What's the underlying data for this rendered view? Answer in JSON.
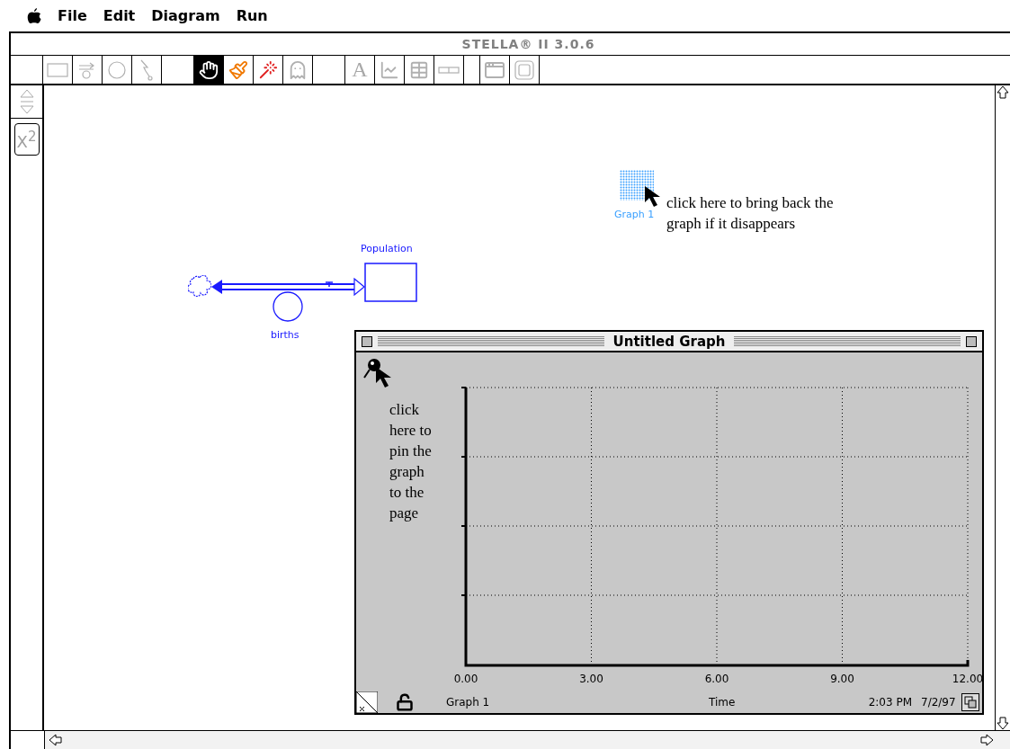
{
  "menu_bar": {
    "items": [
      "File",
      "Edit",
      "Diagram",
      "Run"
    ]
  },
  "window": {
    "title": "STELLA® II 3.0.6"
  },
  "toolbar": {
    "tools": [
      {
        "kind": "stock",
        "selected": false
      },
      {
        "kind": "flow",
        "selected": false
      },
      {
        "kind": "converter",
        "selected": false
      },
      {
        "kind": "connector",
        "selected": false
      },
      {
        "kind": "blank",
        "selected": false
      },
      {
        "kind": "hand",
        "selected": true
      },
      {
        "kind": "paintbrush",
        "selected": false
      },
      {
        "kind": "dynamite",
        "selected": false
      },
      {
        "kind": "ghost",
        "selected": false
      },
      {
        "kind": "blank",
        "selected": false
      },
      {
        "kind": "text",
        "label": "A",
        "selected": false
      },
      {
        "kind": "graph",
        "selected": false
      },
      {
        "kind": "table",
        "selected": false
      },
      {
        "kind": "slider",
        "selected": false
      },
      {
        "kind": "gap",
        "selected": false
      },
      {
        "kind": "window",
        "selected": false
      },
      {
        "kind": "frame",
        "selected": false
      }
    ]
  },
  "side_panel": {
    "builtin_button": "X$^{2}$"
  },
  "diagram": {
    "stock": {
      "label": "Population"
    },
    "flow": {
      "label": "births"
    },
    "graph_pad": {
      "label": "Graph 1"
    },
    "note": "click here to bring back the graph if it disappears"
  },
  "graph_window": {
    "title": "Untitled Graph",
    "note": "click here to pin the graph to the page",
    "plot": {
      "x_tick_labels": [
        "0.00",
        "3.00",
        "6.00",
        "9.00",
        "12.00"
      ]
    },
    "footer": {
      "graph_name": "Graph 1",
      "x_label": "Time",
      "time": "2:03 PM",
      "date": "7/2/97"
    }
  }
}
